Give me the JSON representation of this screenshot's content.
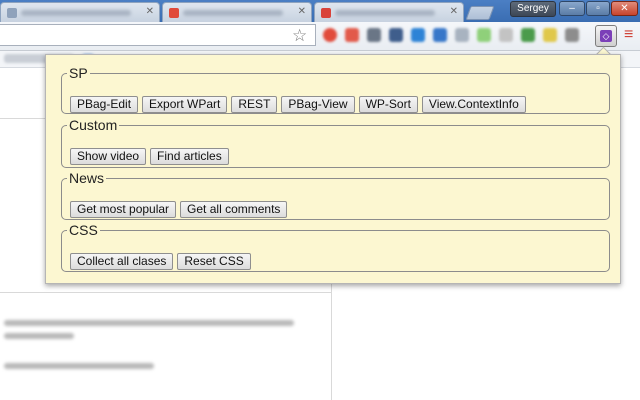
{
  "browser": {
    "user_name": "Sergey",
    "window_buttons": {
      "minimize": "–",
      "restore": "▫",
      "close": "✕"
    },
    "star_glyph": "☆",
    "menu_glyph": "≡"
  },
  "popup": {
    "groups": [
      {
        "title": "SP",
        "buttons": [
          "PBag-Edit",
          "Export WPart",
          "REST",
          "PBag-View",
          "WP-Sort",
          "View.ContextInfo"
        ]
      },
      {
        "title": "Custom",
        "buttons": [
          "Show video",
          "Find articles"
        ]
      },
      {
        "title": "News",
        "buttons": [
          "Get most popular",
          "Get all comments"
        ]
      },
      {
        "title": "CSS",
        "buttons": [
          "Collect all clases",
          "Reset CSS"
        ]
      }
    ]
  },
  "colors": {
    "popup_bg": "#fcf7d1",
    "extension_accent": "#7b3fb8",
    "menu_accent": "#d0453a"
  }
}
